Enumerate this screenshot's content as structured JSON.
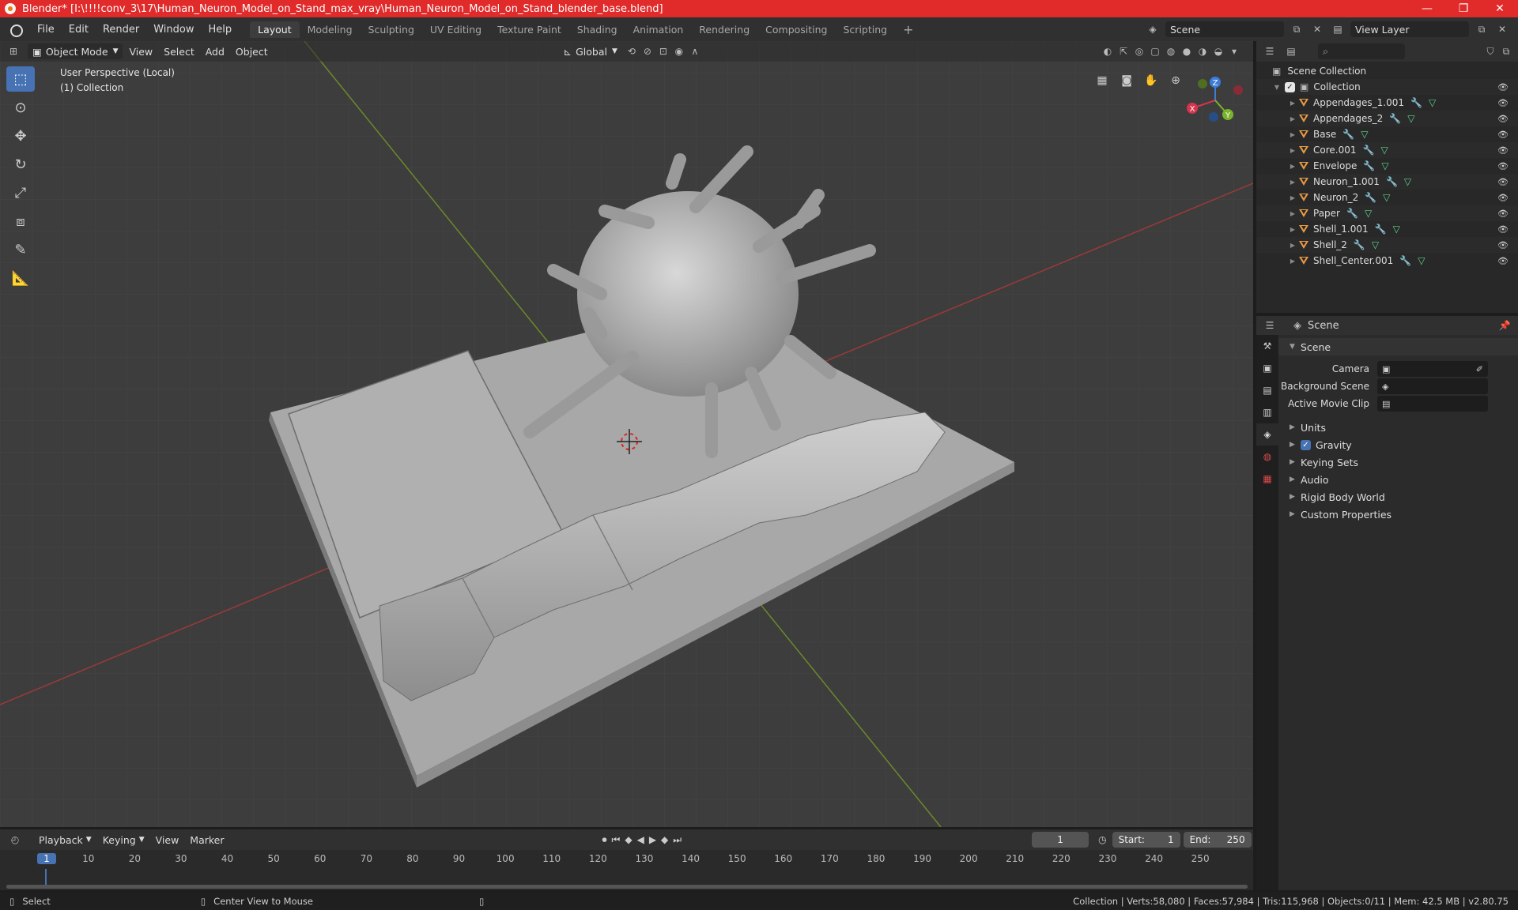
{
  "window": {
    "title": "Blender* [I:\\!!!!conv_3\\17\\Human_Neuron_Model_on_Stand_max_vray\\Human_Neuron_Model_on_Stand_blender_base.blend]",
    "minimize": "—",
    "maximize": "❐",
    "close": "✕"
  },
  "menu": [
    "File",
    "Edit",
    "Render",
    "Window",
    "Help"
  ],
  "workspaces": [
    "Layout",
    "Modeling",
    "Sculpting",
    "UV Editing",
    "Texture Paint",
    "Shading",
    "Animation",
    "Rendering",
    "Compositing",
    "Scripting"
  ],
  "add_workspace": "+",
  "scene_name": "Scene",
  "view_layer": "View Layer",
  "viewport": {
    "mode": "Object Mode",
    "menus": [
      "View",
      "Select",
      "Add",
      "Object"
    ],
    "transform_orientation": "Global",
    "perspective_label": "User Perspective (Local)",
    "collection_label": "(1) Collection",
    "axes": {
      "x": "X",
      "y": "Y",
      "z": "Z"
    }
  },
  "outliner": {
    "root": "Scene Collection",
    "collection": "Collection",
    "objects": [
      "Appendages_1.001",
      "Appendages_2",
      "Base",
      "Core.001",
      "Envelope",
      "Neuron_1.001",
      "Neuron_2",
      "Paper",
      "Shell_1.001",
      "Shell_2",
      "Shell_Center.001"
    ]
  },
  "properties": {
    "context": "Scene",
    "panel": "Scene",
    "rows": [
      {
        "label": "Camera",
        "value": ""
      },
      {
        "label": "Background Scene",
        "value": ""
      },
      {
        "label": "Active Movie Clip",
        "value": ""
      }
    ],
    "subpanels": [
      "Units",
      "Gravity",
      "Keying Sets",
      "Audio",
      "Rigid Body World",
      "Custom Properties"
    ]
  },
  "timeline": {
    "menus": [
      "Playback",
      "Keying",
      "View",
      "Marker"
    ],
    "current_frame": "1",
    "start_label": "Start:",
    "start": "1",
    "end_label": "End:",
    "end": "250",
    "ruler": [
      "1",
      "10",
      "20",
      "30",
      "40",
      "50",
      "60",
      "70",
      "80",
      "90",
      "100",
      "110",
      "120",
      "130",
      "140",
      "150",
      "160",
      "170",
      "180",
      "190",
      "200",
      "210",
      "220",
      "230",
      "240",
      "250"
    ]
  },
  "status": {
    "left": "Select",
    "middle": "Center View to Mouse",
    "right": "Collection | Verts:58,080 | Faces:57,984 | Tris:115,968 | Objects:0/11 | Mem: 42.5 MB | v2.80.75"
  }
}
